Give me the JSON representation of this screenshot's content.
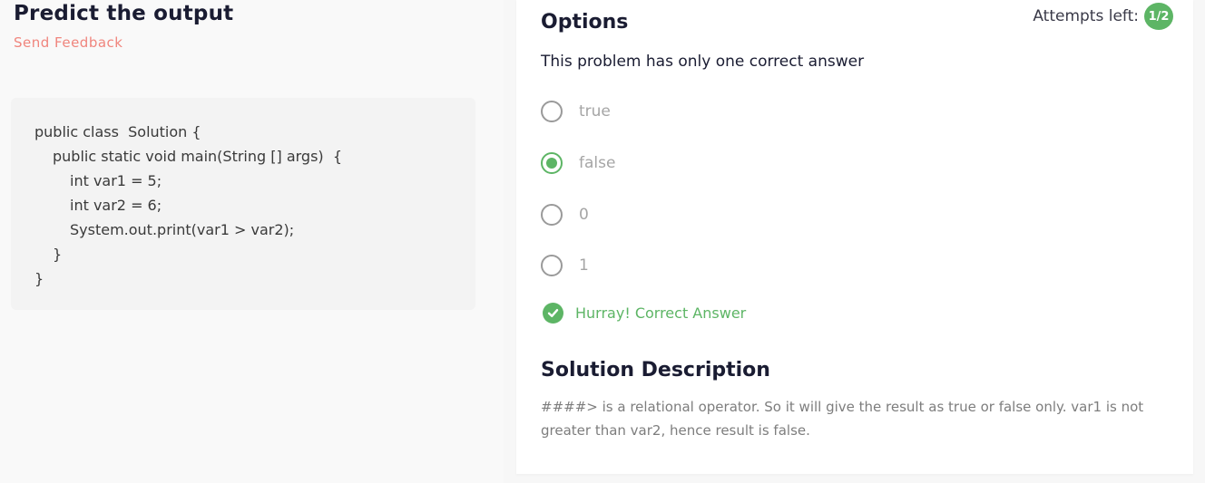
{
  "problem": {
    "title": "Predict the output",
    "feedback_label": "Send Feedback",
    "code_lines": [
      "public class  Solution {",
      "public static void main(String [] args)  {",
      "int var1 = 5;",
      "int var2 = 6;",
      "System.out.print(var1 > var2);",
      "}",
      "}"
    ]
  },
  "options_panel": {
    "heading": "Options",
    "attempts_label": "Attempts left:",
    "attempts_value": "1/2",
    "instruction": "This problem has only one correct answer",
    "options": [
      {
        "label": "true",
        "selected": false
      },
      {
        "label": "false",
        "selected": true
      },
      {
        "label": "0",
        "selected": false
      },
      {
        "label": "1",
        "selected": false
      }
    ],
    "result_text": "Hurray! Correct Answer",
    "solution_heading": "Solution Description",
    "solution_text": "####> is a relational operator. So it will give the result as true or false only. var1 is not greater than var2, hence result is false."
  },
  "colors": {
    "accent_green": "#5db565",
    "feedback_red": "#f0857d",
    "heading_dark": "#1a1c32"
  },
  "icons": {
    "radio_checked": "radio-checked-icon",
    "radio_unchecked": "radio-unchecked-icon",
    "result": "check-circle-icon"
  }
}
